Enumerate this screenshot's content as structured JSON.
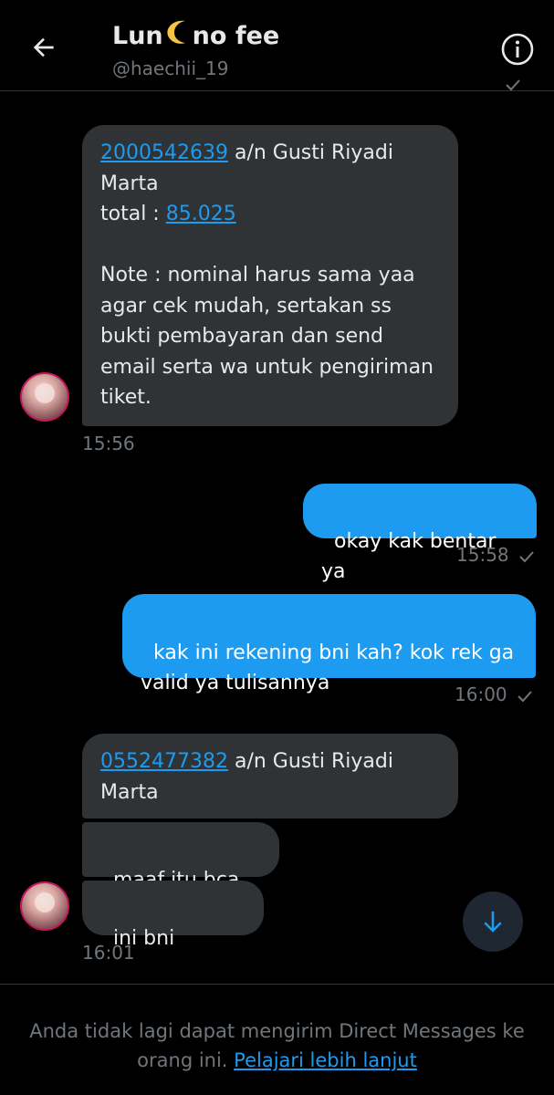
{
  "header": {
    "name_part1": "Lun",
    "name_part2": "no fee",
    "handle": "@haechii_19"
  },
  "messages": [
    {
      "from": "them",
      "link1": "2000542639",
      "text1": " a/n Gusti Riyadi\nMarta\ntotal : ",
      "link2": "85.025",
      "text2": "\n\nNote : nominal harus sama yaa\nagar cek mudah, sertakan ss\nbukti pembayaran dan send\nemail serta wa untuk pengiriman\ntiket.",
      "time": "15:56"
    },
    {
      "from": "me",
      "text": "okay kak bentar ya",
      "time": "15:58"
    },
    {
      "from": "me",
      "text": "kak ini rekening bni kah? kok rek ga\nvalid ya tulisannya",
      "time": "16:00"
    },
    {
      "from": "them",
      "link1": "0552477382",
      "text1": " a/n Gusti Riyadi\nMarta"
    },
    {
      "from": "them",
      "text": "maaf itu bca ku"
    },
    {
      "from": "them",
      "text": "ini bni",
      "time": "16:01"
    }
  ],
  "footer": {
    "text": "Anda tidak lagi dapat mengirim Direct Messages ke\norang ini. ",
    "link": "Pelajari lebih lanjut"
  },
  "colors": {
    "accent": "#1d9bf0",
    "received_bubble": "#2f3336",
    "background": "#000000",
    "muted": "#71767b"
  },
  "icons": [
    "back-arrow-icon",
    "moon-icon",
    "info-icon",
    "check-icon",
    "arrow-down-icon"
  ]
}
